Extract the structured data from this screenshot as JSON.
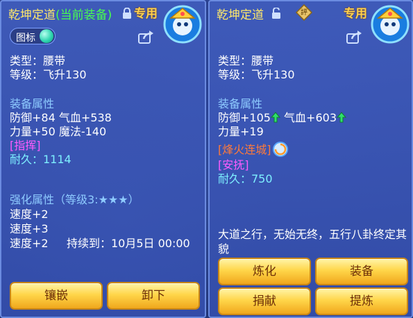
{
  "left": {
    "title_name": "乾坤定道",
    "title_status": "(当前装备)",
    "exclusive_label": "专用",
    "icon_toggle_label": "图标",
    "type_line": "类型：腰带",
    "level_line": "等级：飞升130",
    "attr_heading": "装备属性",
    "attr_line1": "防御+84 气血+538",
    "attr_line2": "力量+50 魔法-140",
    "special": "[指挥]",
    "durability": "耐久：1114",
    "enhance_heading": "强化属性（等级3:★★★）",
    "enhance_line1": "速度+2",
    "enhance_line2": "速度+3",
    "enhance_line3": "速度+2",
    "enhance_duration": "持续到：10月5日 00:00",
    "buttons": {
      "inlay": "镶嵌",
      "unequip": "卸下"
    }
  },
  "right": {
    "title_name": "乾坤定道",
    "diamond_label": "評",
    "exclusive_label": "专用",
    "type_line": "类型：腰带",
    "level_line": "等级：飞升130",
    "attr_heading": "装备属性",
    "attr_defense": "防御+105",
    "attr_hp": "气血+603",
    "attr_line2": "力量+19",
    "special1": "[烽火连城]",
    "special2": "[安抚]",
    "durability": "耐久：750",
    "description": "大道之行，无始无终，五行八卦终定其貌",
    "buttons": {
      "refine": "炼化",
      "equip": "装备",
      "donate": "捐献",
      "purify": "提炼"
    }
  },
  "colors": {
    "title": "#ffe86a",
    "equipped": "#49ff4e",
    "heading": "#8ecbff",
    "special_magenta": "#ff5cff",
    "special_orange": "#ff7a3a",
    "durability": "#7ef0ff",
    "button_text": "#6b2e08"
  }
}
